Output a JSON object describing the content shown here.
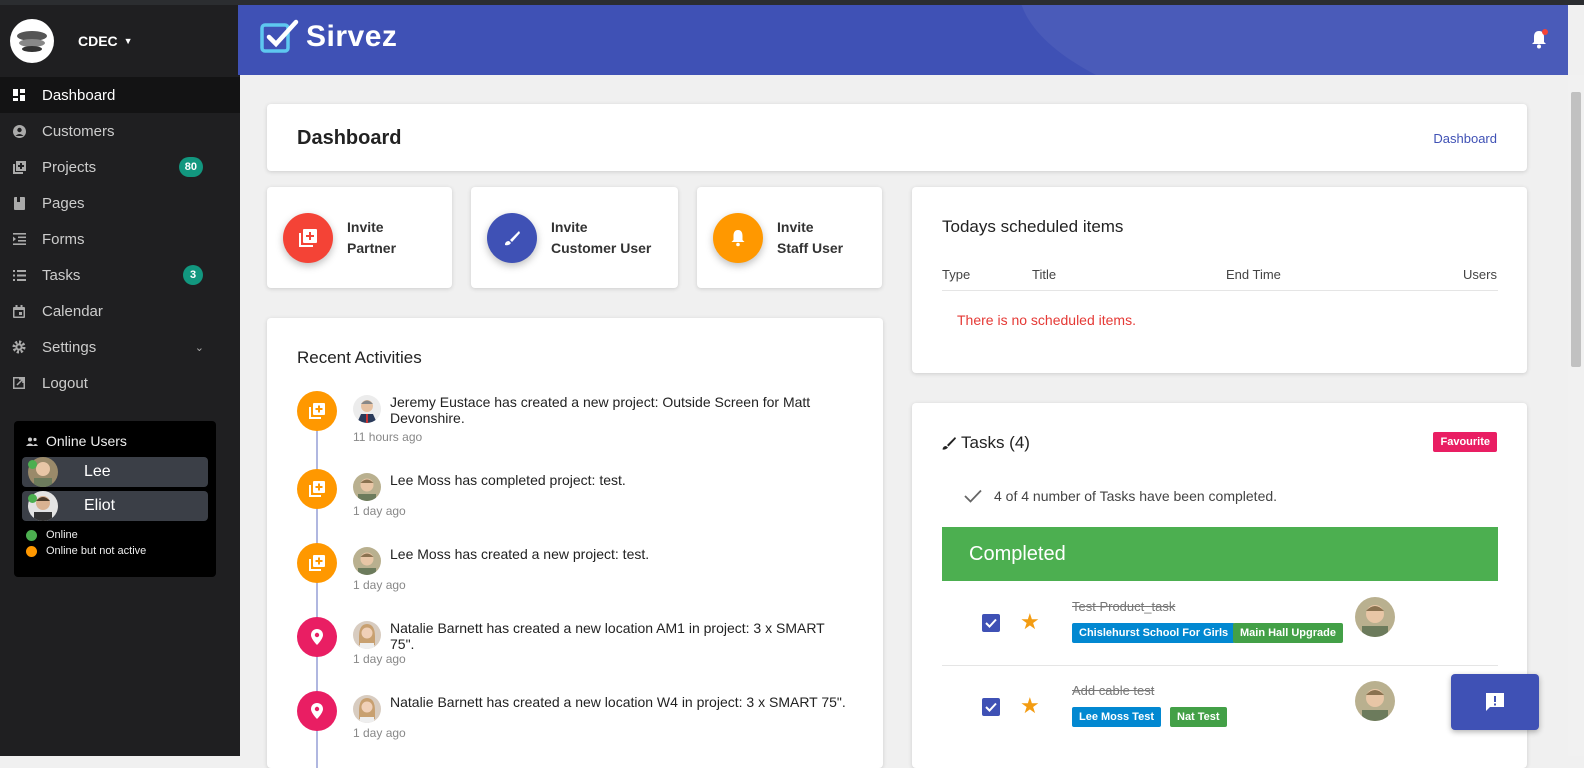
{
  "app": {
    "org_name": "CDEC",
    "brand_name": "Sirvez"
  },
  "sidebar": {
    "items": [
      {
        "label": "Dashboard",
        "icon": "dashboard-icon"
      },
      {
        "label": "Customers",
        "icon": "account-circle-icon"
      },
      {
        "label": "Projects",
        "icon": "projects-icon",
        "badge": "80"
      },
      {
        "label": "Pages",
        "icon": "book-icon"
      },
      {
        "label": "Forms",
        "icon": "forms-icon"
      },
      {
        "label": "Tasks",
        "icon": "list-icon",
        "badge": "3"
      },
      {
        "label": "Calendar",
        "icon": "calendar-icon"
      },
      {
        "label": "Settings",
        "icon": "gear-icon"
      },
      {
        "label": "Logout",
        "icon": "logout-icon"
      }
    ]
  },
  "online_users": {
    "title": "Online Users",
    "users": [
      {
        "name": "Lee"
      },
      {
        "name": "Eliot"
      }
    ],
    "legend": [
      {
        "label": "Online",
        "color": "#4caf50"
      },
      {
        "label": "Online but not active",
        "color": "#ff9800"
      }
    ]
  },
  "page": {
    "title": "Dashboard",
    "breadcrumb": "Dashboard"
  },
  "invites": [
    {
      "line1": "Invite",
      "line2": "Partner",
      "color": "#f44336",
      "icon": "add-box-icon"
    },
    {
      "line1": "Invite",
      "line2": "Customer User",
      "color": "#3f51b5",
      "icon": "brush-icon"
    },
    {
      "line1": "Invite",
      "line2": "Staff User",
      "color": "#ff9800",
      "icon": "bell-icon"
    }
  ],
  "scheduled": {
    "title": "Todays scheduled items",
    "columns": [
      "Type",
      "Title",
      "End Time",
      "Users"
    ],
    "empty_message": "There is no scheduled items."
  },
  "activities": {
    "title": "Recent Activities",
    "items": [
      {
        "text": "Jeremy Eustace has created a new project: Outside Screen for Matt Devonshire.",
        "time": "11 hours ago",
        "color": "#ff9800",
        "icon": "add-box-icon"
      },
      {
        "text": "Lee Moss has completed project: test.",
        "time": "1 day ago",
        "color": "#ff9800",
        "icon": "add-box-icon"
      },
      {
        "text": "Lee Moss has created a new project: test.",
        "time": "1 day ago",
        "color": "#ff9800",
        "icon": "add-box-icon"
      },
      {
        "text": "Natalie Barnett has created a new location AM1 in project: 3 x SMART 75\".",
        "time": "1 day ago",
        "color": "#e91e63",
        "icon": "location-pin-icon"
      },
      {
        "text": "Natalie Barnett has created a new location W4 in project: 3 x SMART 75\".",
        "time": "1 day ago",
        "color": "#e91e63",
        "icon": "location-pin-icon"
      }
    ]
  },
  "tasks": {
    "title": "Tasks (4)",
    "favourite_label": "Favourite",
    "completed_summary": "4 of 4 number of Tasks have been completed.",
    "completed_header": "Completed",
    "items": [
      {
        "name": "Test Product_task",
        "tags": [
          {
            "label": "Chislehurst School For Girls",
            "color": "#0288d1"
          },
          {
            "label": "Main Hall Upgrade",
            "color": "#43a047"
          }
        ]
      },
      {
        "name": "Add cable test",
        "tags": [
          {
            "label": "Lee Moss Test",
            "color": "#0288d1"
          },
          {
            "label": "Nat Test",
            "color": "#43a047"
          }
        ]
      }
    ]
  }
}
